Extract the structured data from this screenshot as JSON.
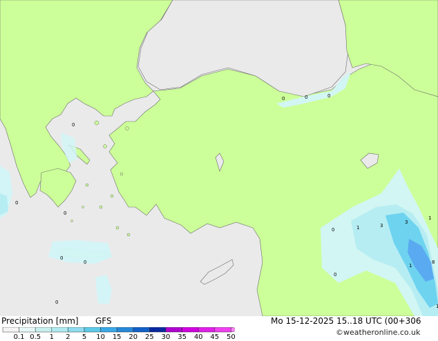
{
  "legend": {
    "title": "Precipitation [mm]",
    "model": "GFS",
    "ticks": [
      "0.1",
      "0.5",
      "1",
      "2",
      "5",
      "10",
      "15",
      "20",
      "25",
      "30",
      "35",
      "40",
      "45",
      "50"
    ],
    "colors": [
      "#f5f5f5",
      "#e6f8f8",
      "#c8f0f0",
      "#b0eaf0",
      "#8edcf0",
      "#5ccae8",
      "#3aa8e8",
      "#2888d8",
      "#1060c8",
      "#0828a0",
      "#b000d0",
      "#d000e0",
      "#e020e8",
      "#f040f0",
      "#ff80ff"
    ]
  },
  "run_info": "Mo 15-12-2025 15..18 UTC (00+306",
  "credit": "©weatheronline.co.uk",
  "map": {
    "colors": {
      "sea": "#eaeaea",
      "land": "#ccff99",
      "light_precip": "#d2f6f8",
      "medium_precip": "#b4ecf2",
      "heavy_precip": "#6ad2ee",
      "strong_precip": "#58a8f0",
      "border": "#6a6a6a"
    },
    "point_values": [
      {
        "id": "bs1",
        "value": "0"
      },
      {
        "id": "bs2",
        "value": "0"
      },
      {
        "id": "bs3",
        "value": "0"
      },
      {
        "id": "ae1",
        "value": "0"
      },
      {
        "id": "io1",
        "value": "0"
      },
      {
        "id": "ae2",
        "value": "0"
      },
      {
        "id": "cr1",
        "value": "0"
      },
      {
        "id": "cr2",
        "value": "0"
      },
      {
        "id": "med1",
        "value": "0"
      },
      {
        "id": "ir1",
        "value": "0"
      },
      {
        "id": "ir2",
        "value": "1"
      },
      {
        "id": "ir3",
        "value": "3"
      },
      {
        "id": "ir4",
        "value": "3"
      },
      {
        "id": "ir5",
        "value": "1"
      },
      {
        "id": "ir6",
        "value": "1"
      },
      {
        "id": "ir7",
        "value": "8"
      },
      {
        "id": "sy1",
        "value": "0"
      },
      {
        "id": "ir8",
        "value": "1"
      }
    ]
  }
}
